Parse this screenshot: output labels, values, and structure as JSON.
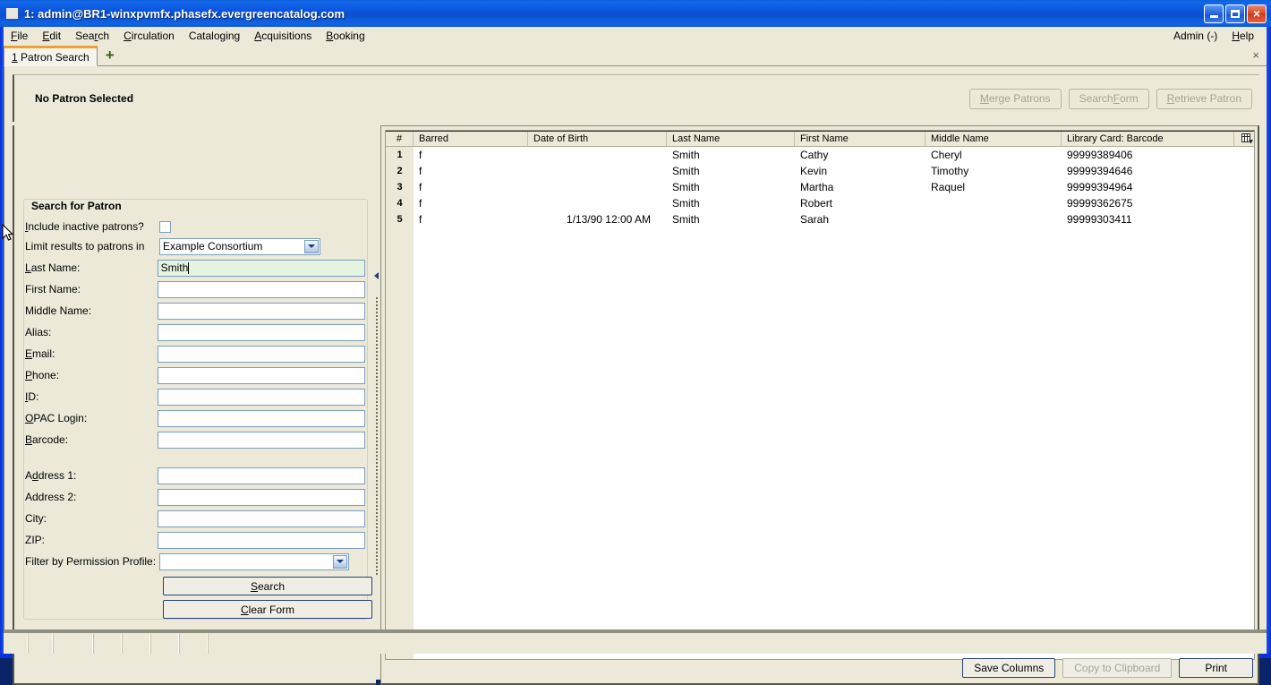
{
  "window": {
    "title": "1: admin@BR1-winxpvmfx.phasefx.evergreencatalog.com",
    "minimize_label": "–",
    "maximize_label": "",
    "close_label": "×"
  },
  "menubar": {
    "items": [
      {
        "label": "File",
        "accel": "F"
      },
      {
        "label": "Edit",
        "accel": "E"
      },
      {
        "label": "Search",
        "accel": "r"
      },
      {
        "label": "Circulation",
        "accel": "C"
      },
      {
        "label": "Cataloging",
        "accel": "g"
      },
      {
        "label": "Acquisitions",
        "accel": "A"
      },
      {
        "label": "Booking",
        "accel": "B"
      }
    ],
    "right_items": [
      {
        "label": "Admin (-)"
      },
      {
        "label": "Help"
      }
    ]
  },
  "tabbar": {
    "active_tab": "1 Patron Search",
    "new_tab_label": "+",
    "close_label": "×"
  },
  "patron_header": {
    "title": "No Patron Selected",
    "buttons": [
      {
        "label": "Merge Patrons",
        "enabled": false
      },
      {
        "label": "Search Form",
        "enabled": false
      },
      {
        "label": "Retrieve Patron",
        "enabled": false
      }
    ]
  },
  "search_form": {
    "legend": "Search for Patron",
    "fields": [
      {
        "label": "Include inactive patrons?",
        "type": "checkbox",
        "value": "",
        "checked": false
      },
      {
        "label": "Limit results to patrons in",
        "type": "select",
        "value": "Example Consortium"
      },
      {
        "label": "Last Name:",
        "type": "text",
        "value": "Smith",
        "focused": true
      },
      {
        "label": "First Name:",
        "type": "text",
        "value": ""
      },
      {
        "label": "Middle Name:",
        "type": "text",
        "value": ""
      },
      {
        "label": "Alias:",
        "type": "text",
        "value": ""
      },
      {
        "label": "Email:",
        "type": "text",
        "value": ""
      },
      {
        "label": "Phone:",
        "type": "text",
        "value": ""
      },
      {
        "label": "ID:",
        "type": "text",
        "value": ""
      },
      {
        "label": "OPAC Login:",
        "type": "text",
        "value": ""
      },
      {
        "label": "Barcode:",
        "type": "text",
        "value": ""
      },
      {
        "label": "Address 1:",
        "type": "text",
        "value": ""
      },
      {
        "label": "Address 2:",
        "type": "text",
        "value": ""
      },
      {
        "label": "City:",
        "type": "text",
        "value": ""
      },
      {
        "label": "ZIP:",
        "type": "text",
        "value": ""
      },
      {
        "label": "Filter by Permission Profile:",
        "type": "select",
        "value": ""
      }
    ],
    "search_button": "Search",
    "clear_button": "Clear Form"
  },
  "results": {
    "columns": [
      "#",
      "Barred",
      "Date of Birth",
      "Last Name",
      "First Name",
      "Middle Name",
      "Library Card: Barcode"
    ],
    "rows": [
      {
        "num": "1",
        "barred": "f",
        "dob": "",
        "last": "Smith",
        "first": "Cathy",
        "middle": "Cheryl",
        "barcode": "99999389406"
      },
      {
        "num": "2",
        "barred": "f",
        "dob": "",
        "last": "Smith",
        "first": "Kevin",
        "middle": "Timothy",
        "barcode": "99999394646"
      },
      {
        "num": "3",
        "barred": "f",
        "dob": "",
        "last": "Smith",
        "first": "Martha",
        "middle": "Raquel",
        "barcode": "99999394964"
      },
      {
        "num": "4",
        "barred": "f",
        "dob": "",
        "last": "Smith",
        "first": "Robert",
        "middle": "",
        "barcode": "99999362675"
      },
      {
        "num": "5",
        "barred": "f",
        "dob": "1/13/90 12:00 AM",
        "last": "Smith",
        "first": "Sarah",
        "middle": "",
        "barcode": "99999303411"
      }
    ],
    "column_picker_icon": "column-picker-icon",
    "buttons": [
      {
        "label": "Save Columns",
        "enabled": true
      },
      {
        "label": "Copy to Clipboard",
        "enabled": false
      },
      {
        "label": "Print",
        "enabled": true
      }
    ]
  },
  "colors": {
    "titlebar_blue": "#0b55dd",
    "window_bg": "#ece9d8",
    "focus_field_green": "#e3f5e0",
    "tab_accent_orange": "#f0a030",
    "default_button_border": "#26427a"
  }
}
